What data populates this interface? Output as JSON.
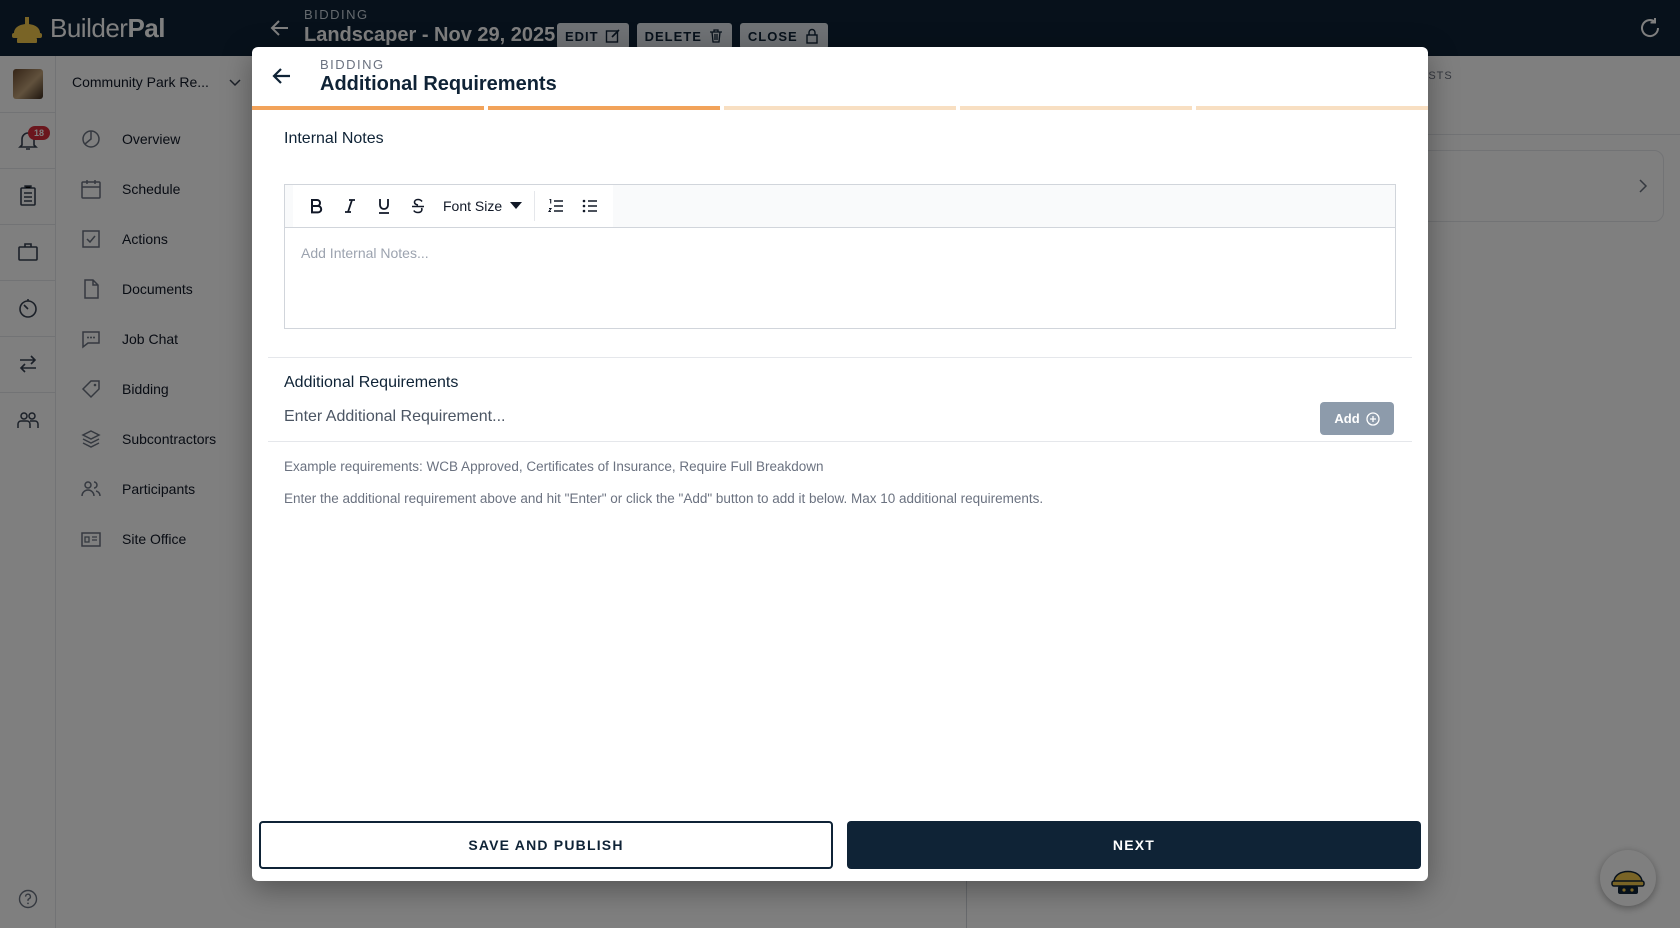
{
  "app": {
    "logo_regular": "Builder",
    "logo_bold": "Pal"
  },
  "topbar": {
    "eyebrow": "BIDDING",
    "title": "Landscaper - Nov 29, 2025",
    "edit_label": "EDIT",
    "delete_label": "DELETE",
    "close_label": "CLOSE"
  },
  "rail": {
    "notification_count": "18"
  },
  "project": {
    "name": "Community Park Re..."
  },
  "sidebar": {
    "items": [
      {
        "label": "Overview",
        "icon": "overview-icon"
      },
      {
        "label": "Schedule",
        "icon": "calendar-icon"
      },
      {
        "label": "Actions",
        "icon": "checkbox-icon"
      },
      {
        "label": "Documents",
        "icon": "document-icon"
      },
      {
        "label": "Job Chat",
        "icon": "chat-icon"
      },
      {
        "label": "Bidding",
        "icon": "tag-icon"
      },
      {
        "label": "Subcontractors",
        "icon": "layers-icon"
      },
      {
        "label": "Participants",
        "icon": "people-icon"
      },
      {
        "label": "Site Office",
        "icon": "site-office-icon"
      }
    ]
  },
  "background": {
    "tab_fragment": "ESTS"
  },
  "modal": {
    "eyebrow": "BIDDING",
    "title": "Additional Requirements",
    "steps": [
      {
        "state": "complete"
      },
      {
        "state": "complete"
      },
      {
        "state": "pending"
      },
      {
        "state": "pending"
      },
      {
        "state": "pending"
      }
    ],
    "internal_notes": {
      "label": "Internal Notes",
      "placeholder": "Add Internal Notes...",
      "font_size_label": "Font Size"
    },
    "requirements": {
      "label": "Additional Requirements",
      "placeholder": "Enter Additional Requirement...",
      "add_label": "Add",
      "hint_examples": "Example requirements: WCB Approved, Certificates of Insurance, Require Full Breakdown",
      "hint_instructions": "Enter the additional requirement above and hit \"Enter\" or click the \"Add\" button to add it below. Max 10 additional requirements."
    },
    "footer": {
      "save_publish_label": "SAVE AND PUBLISH",
      "next_label": "NEXT"
    }
  },
  "colors": {
    "brand_navy": "#0f2336",
    "step_complete": "#f2a35a",
    "step_pending": "#f8dfc2",
    "add_button": "#8d9bab",
    "badge_red": "#d62d3b"
  }
}
